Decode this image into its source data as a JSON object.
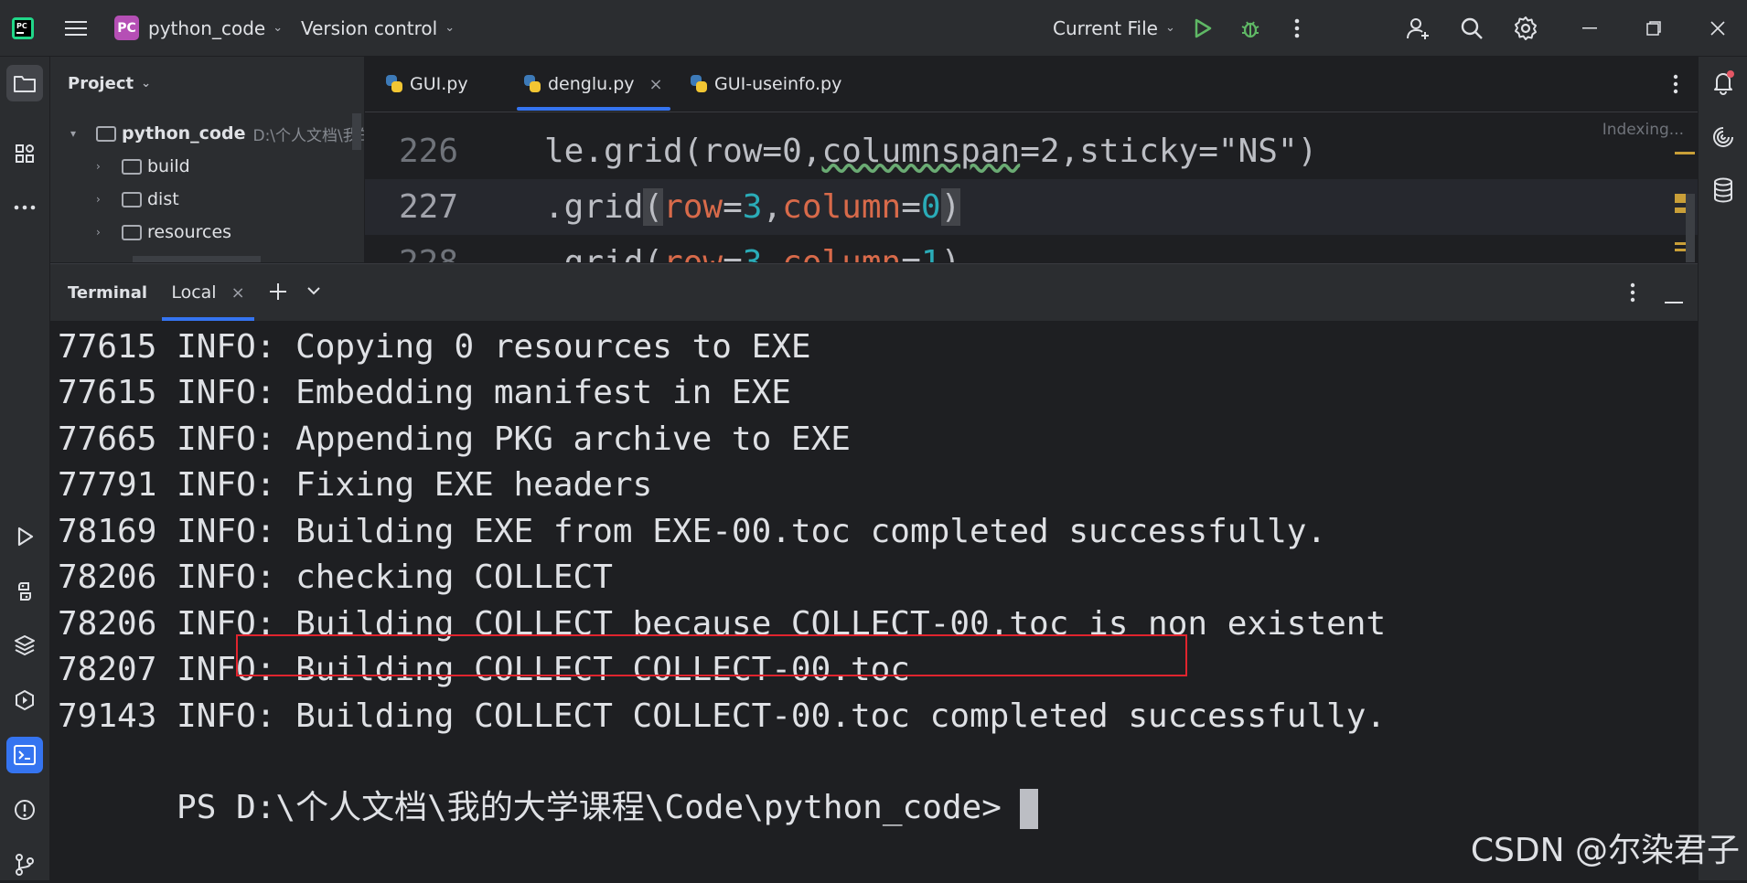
{
  "titlebar": {
    "project_badge": "PC",
    "project_name": "python_code",
    "vcs_label": "Version control",
    "run_config": "Current File"
  },
  "project_panel": {
    "header": "Project",
    "root_name": "python_code",
    "root_path": "D:\\个人文档\\我的",
    "items": [
      {
        "label": "build"
      },
      {
        "label": "dist"
      },
      {
        "label": "resources"
      }
    ]
  },
  "editor": {
    "tabs": [
      {
        "label": "GUI.py"
      },
      {
        "label": "denglu.py"
      },
      {
        "label": "GUI-useinfo.py"
      }
    ],
    "indexing": "Indexing...",
    "lines": [
      {
        "num": "226"
      },
      {
        "num": "227"
      },
      {
        "num": "228"
      }
    ]
  },
  "terminal": {
    "title": "Terminal",
    "tab_label": "Local",
    "lines": [
      "77615 INFO: Copying 0 resources to EXE",
      "77615 INFO: Embedding manifest in EXE",
      "77665 INFO: Appending PKG archive to EXE",
      "77791 INFO: Fixing EXE headers",
      "78169 INFO: Building EXE from EXE-00.toc completed successfully.",
      "78206 INFO: checking COLLECT",
      "78206 INFO: Building COLLECT because COLLECT-00.toc is non existent",
      "78207 INFO: Building COLLECT COLLECT-00.toc",
      "79143 INFO: Building COLLECT COLLECT-00.toc completed successfully."
    ],
    "prompt": "PS D:\\个人文档\\我的大学课程\\Code\\python_code>"
  },
  "watermark": "CSDN @尔染君子",
  "colors": {
    "accent": "#3574f0",
    "highlight_box": "#e0242e",
    "run_green": "#5fb865",
    "project_badge": "#b54fb5"
  }
}
